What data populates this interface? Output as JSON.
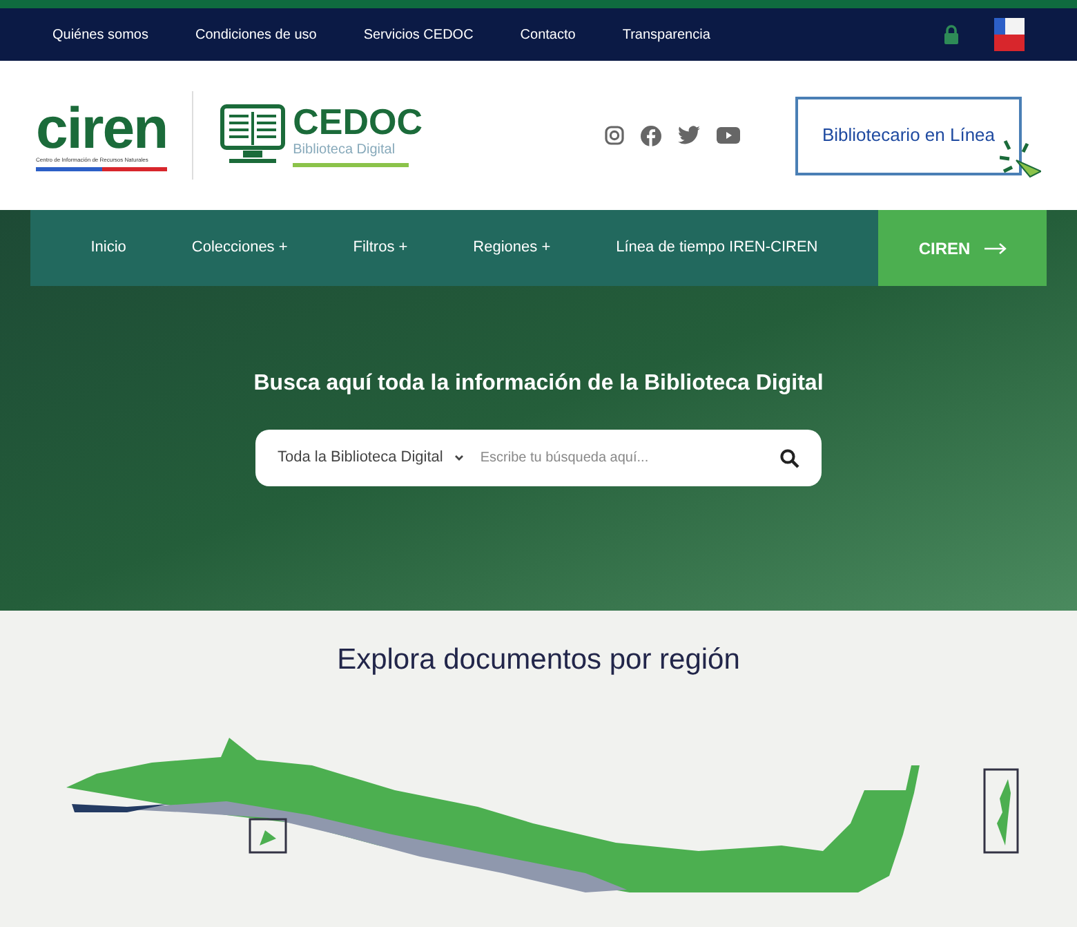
{
  "top_bar": {
    "links": [
      "Quiénes somos",
      "Condiciones de uso",
      "Servicios CEDOC",
      "Contacto",
      "Transparencia"
    ]
  },
  "header": {
    "logo_text": "ciren",
    "logo_tagline": "Centro de Información de Recursos Naturales",
    "cedoc_title": "CEDOC",
    "cedoc_subtitle": "Biblioteca Digital",
    "librarian_button": "Bibliotecario en Línea"
  },
  "nav": {
    "items": [
      "Inicio",
      "Colecciones +",
      "Filtros +",
      "Regiones +",
      "Línea de tiempo IREN-CIREN"
    ],
    "cta": "CIREN"
  },
  "hero": {
    "title": "Busca aquí toda la información de la Biblioteca Digital",
    "scope": "Toda la Biblioteca Digital",
    "placeholder": "Escribe tu búsqueda aquí..."
  },
  "map_section": {
    "title": "Explora documentos por región"
  }
}
